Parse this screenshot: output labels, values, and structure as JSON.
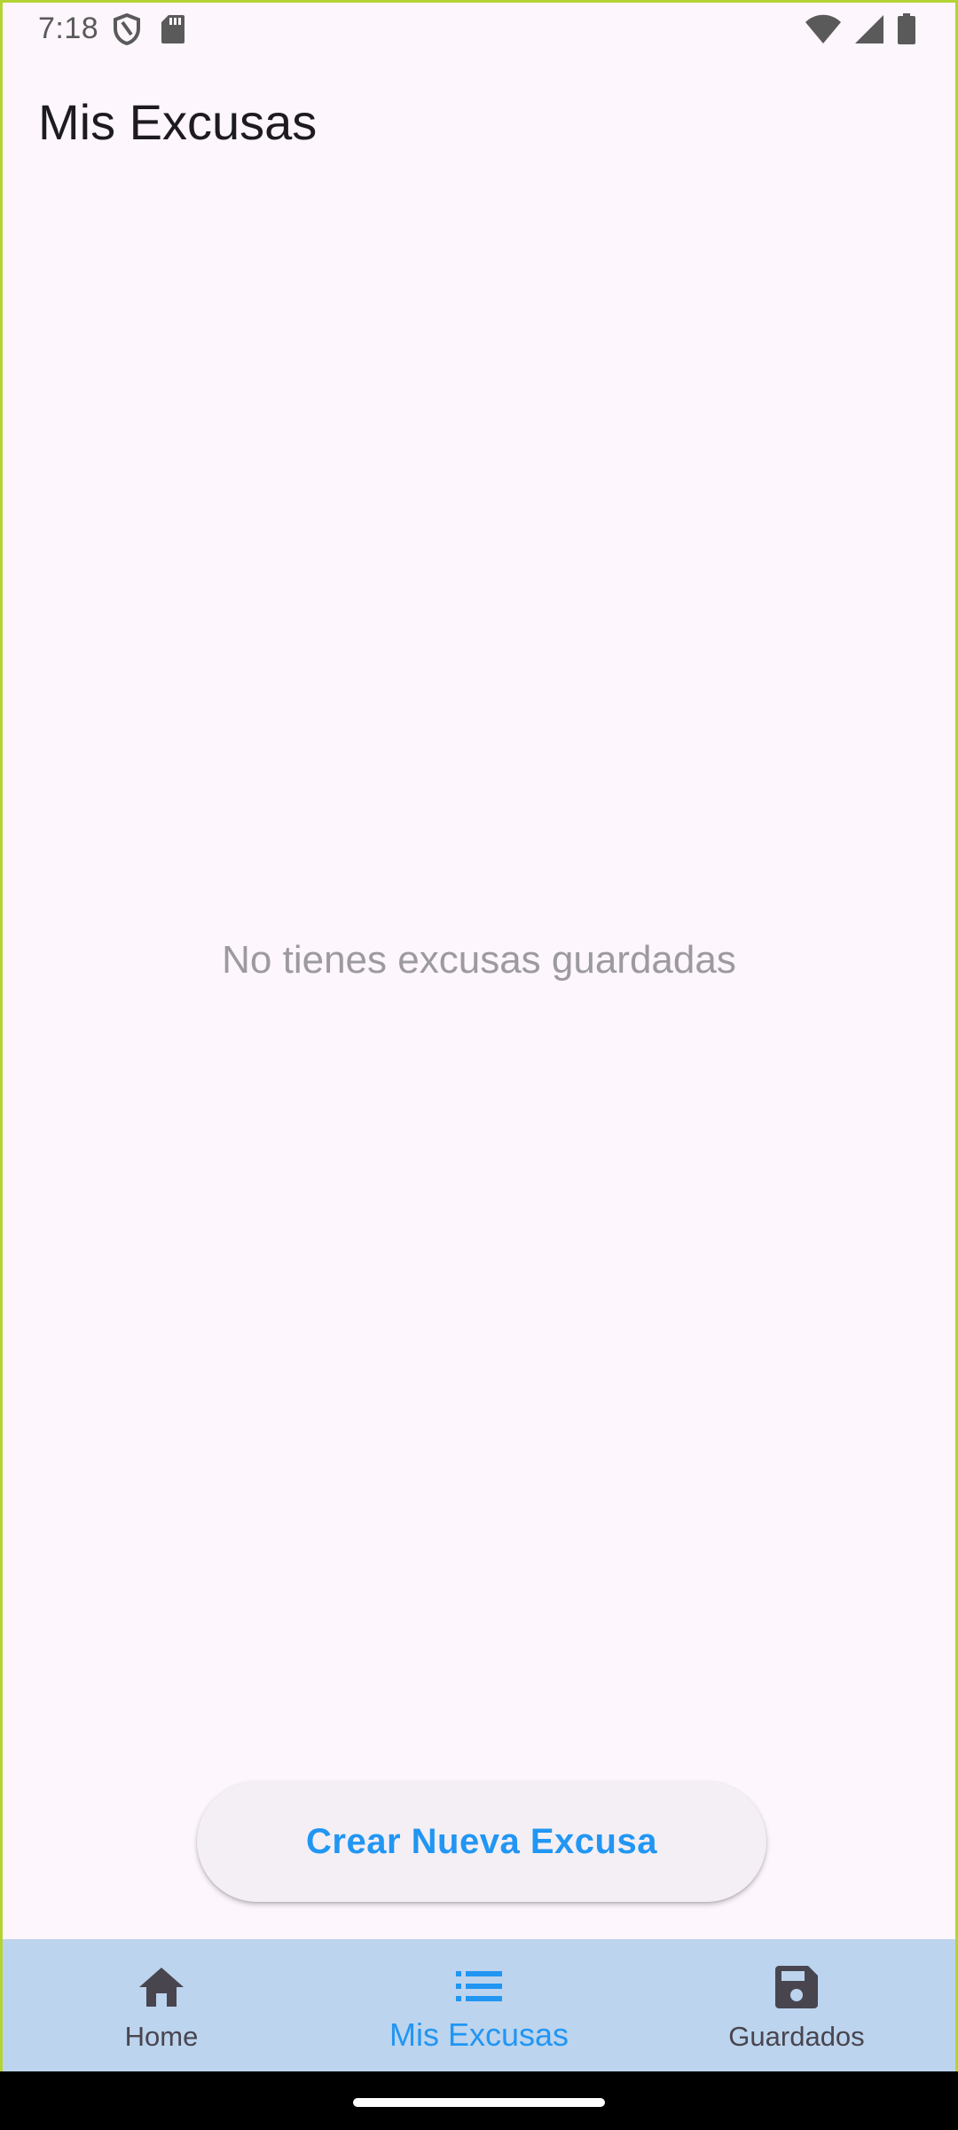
{
  "status_bar": {
    "time": "7:18",
    "left_icons": [
      "shield-icon",
      "sd-card-icon"
    ],
    "right_icons": [
      "wifi-icon",
      "cellular-signal-icon",
      "battery-icon"
    ]
  },
  "app_bar": {
    "title": "Mis Excusas"
  },
  "content": {
    "empty_message": "No tienes excusas guardadas"
  },
  "actions": {
    "create_label": "Crear Nueva Excusa"
  },
  "bottom_nav": {
    "items": [
      {
        "label": "Home",
        "icon": "home-icon",
        "active": false
      },
      {
        "label": "Mis Excusas",
        "icon": "list-icon",
        "active": true
      },
      {
        "label": "Guardados",
        "icon": "save-icon",
        "active": false
      }
    ]
  },
  "colors": {
    "accent": "#2196f3",
    "background": "#fdf6fc",
    "nav_background": "#bcd4ee",
    "frame": "#b3d335"
  }
}
